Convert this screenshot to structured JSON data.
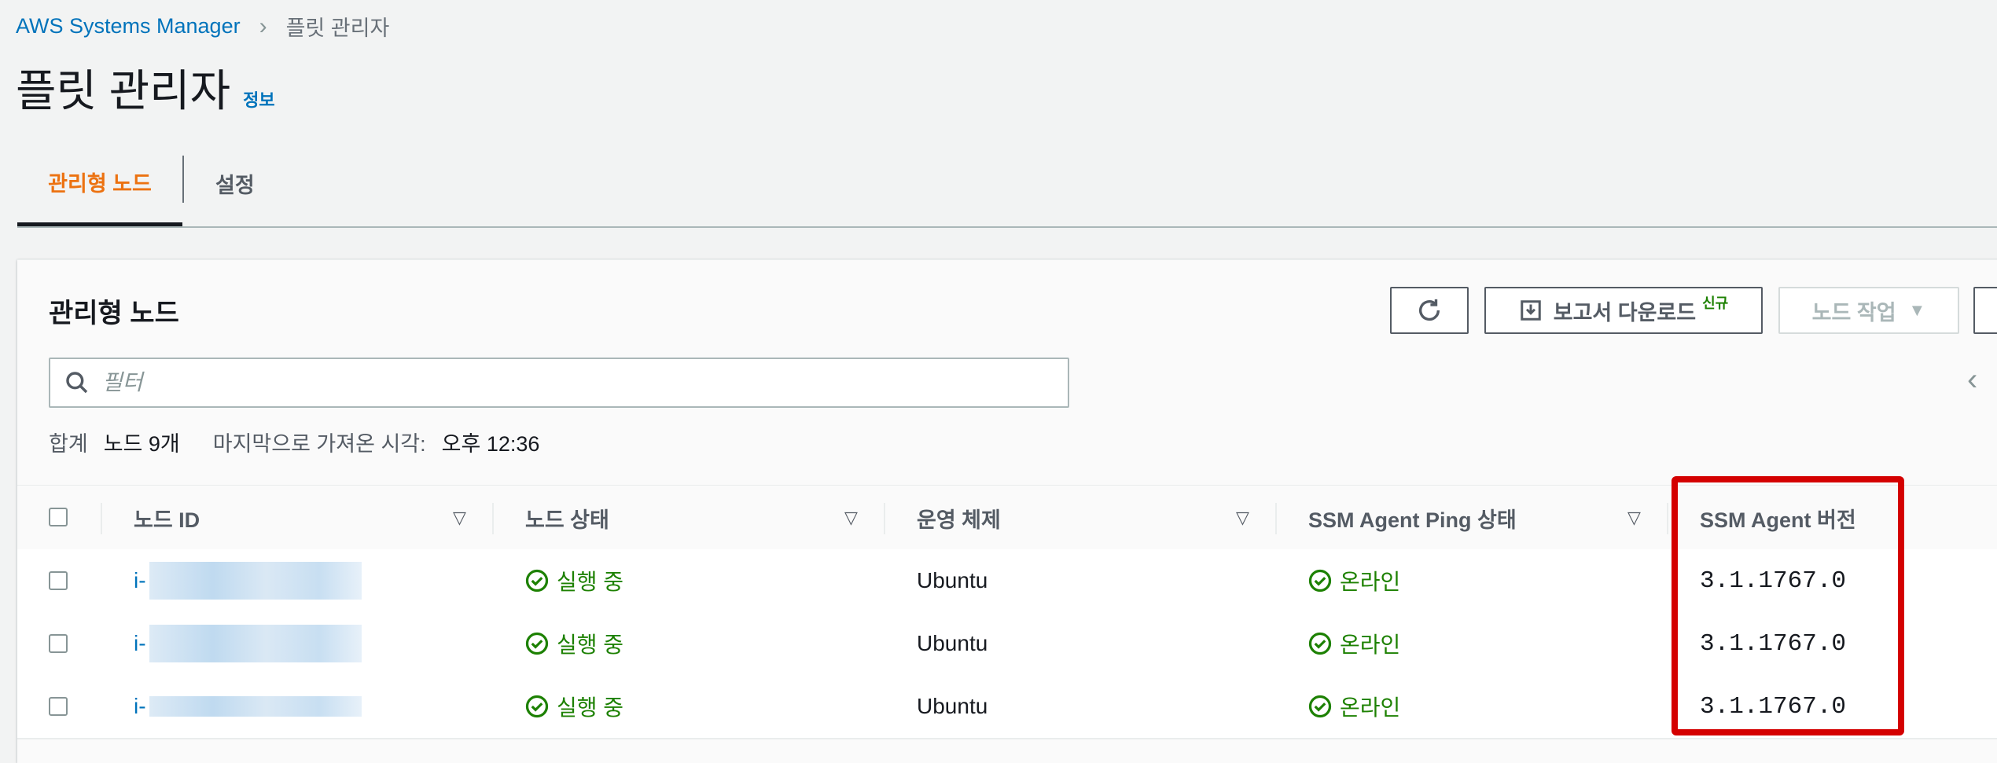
{
  "breadcrumb": {
    "root": "AWS Systems Manager",
    "current": "플릿 관리자"
  },
  "page": {
    "title": "플릿 관리자",
    "info": "정보"
  },
  "tabs": [
    {
      "label": "관리형 노드",
      "active": true
    },
    {
      "label": "설정",
      "active": false
    }
  ],
  "panel": {
    "title": "관리형 노드",
    "report_button": "보고서 다운로드",
    "report_badge": "신규",
    "node_action_button": "노드 작업",
    "search_placeholder": "필터",
    "summary": {
      "total_label": "합계",
      "total_value": "노드 9개",
      "fetched_label": "마지막으로 가져온 시각:",
      "fetched_value": "오후 12:36"
    }
  },
  "table": {
    "columns": [
      "노드 ID",
      "노드 상태",
      "운영 체제",
      "SSM Agent Ping 상태",
      "SSM Agent 버전"
    ],
    "rows": [
      {
        "id_prefix": "i-",
        "state": "실행 중",
        "os": "Ubuntu",
        "ping": "온라인",
        "version": "3.1.1767.0"
      },
      {
        "id_prefix": "i-",
        "state": "실행 중",
        "os": "Ubuntu",
        "ping": "온라인",
        "version": "3.1.1767.0"
      },
      {
        "id_prefix": "i-",
        "state": "실행 중",
        "os": "Ubuntu",
        "ping": "온라인",
        "version": "3.1.1767.0"
      }
    ]
  },
  "colors": {
    "accent": "#ec7211",
    "link": "#0073bb",
    "success": "#1d8102",
    "highlight": "#d40000"
  }
}
